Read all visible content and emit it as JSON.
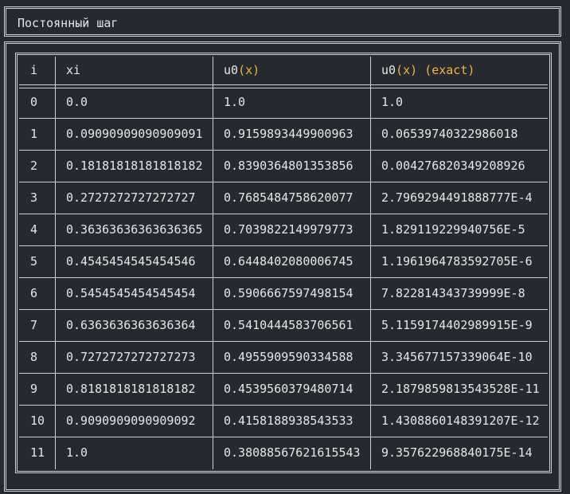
{
  "title": "Постоянный шаг",
  "colors": {
    "background": "#262a30",
    "border": "#cfd3d8",
    "text": "#e6e6e6",
    "accent": "#f0b43c"
  },
  "table": {
    "headers": [
      {
        "parts": [
          {
            "text": "i",
            "accent": false
          }
        ]
      },
      {
        "parts": [
          {
            "text": "xi",
            "accent": false
          }
        ]
      },
      {
        "parts": [
          {
            "text": "u0",
            "accent": false
          },
          {
            "text": "(x)",
            "accent": true
          }
        ]
      },
      {
        "parts": [
          {
            "text": "u0",
            "accent": false
          },
          {
            "text": "(x)",
            "accent": true
          },
          {
            "text": " ",
            "accent": false
          },
          {
            "text": "(exact)",
            "accent": true
          }
        ]
      }
    ],
    "rows": [
      [
        "0",
        "0.0",
        "1.0",
        "1.0"
      ],
      [
        "1",
        "0.09090909090909091",
        "0.9159893449900963",
        "0.06539740322986018"
      ],
      [
        "2",
        "0.18181818181818182",
        "0.8390364801353856",
        "0.004276820349208926"
      ],
      [
        "3",
        "0.2727272727272727",
        "0.7685484758620077",
        "2.7969294491888777E-4"
      ],
      [
        "4",
        "0.36363636363636365",
        "0.7039822149979773",
        "1.829119229940756E-5"
      ],
      [
        "5",
        "0.4545454545454546",
        "0.6448402080006745",
        "1.1961964783592705E-6"
      ],
      [
        "6",
        "0.5454545454545454",
        "0.5906667597498154",
        "7.822814343739999E-8"
      ],
      [
        "7",
        "0.6363636363636364",
        "0.5410444583706561",
        "5.1159174402989915E-9"
      ],
      [
        "8",
        "0.7272727272727273",
        "0.4955909590334588",
        "3.345677157339064E-10"
      ],
      [
        "9",
        "0.8181818181818182",
        "0.4539560379480714",
        "2.1879859813543528E-11"
      ],
      [
        "10",
        "0.9090909090909092",
        "0.4158188938543533",
        "1.4308860148391207E-12"
      ],
      [
        "11",
        "1.0",
        "0.38088567621615543",
        "9.357622968840175E-14"
      ]
    ]
  }
}
